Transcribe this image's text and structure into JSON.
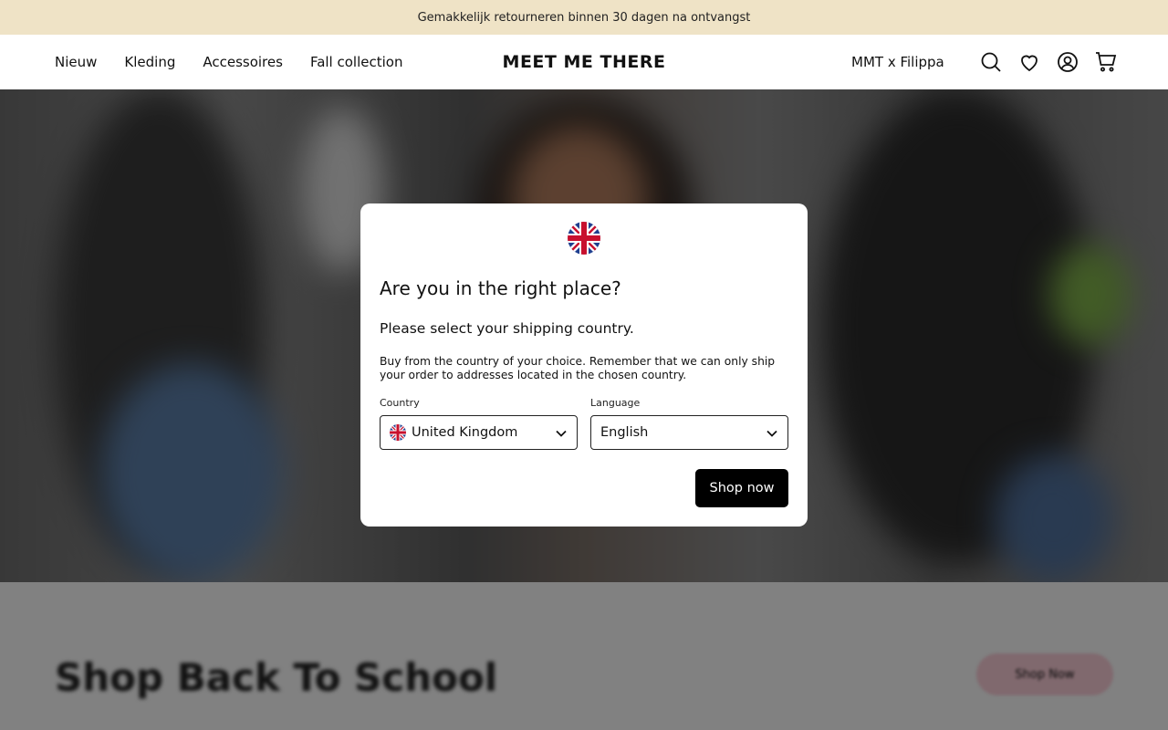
{
  "announcement": {
    "text": "Gemakkelijk retourneren binnen 30 dagen na ontvangst"
  },
  "header": {
    "nav": [
      "Nieuw",
      "Kleding",
      "Accessoires",
      "Fall collection"
    ],
    "logo": "MEET ME THERE",
    "collab_link": "MMT x Filippa",
    "icons": [
      "search-icon",
      "heart-icon",
      "account-icon",
      "cart-icon"
    ]
  },
  "section": {
    "title": "Shop Back To School",
    "button": "Shop Now"
  },
  "modal": {
    "title": "Are you in the right place?",
    "subtitle": "Please select your shipping country.",
    "description": "Buy from the country of your choice. Remember that we can only ship your order to addresses located in the chosen country.",
    "country_label": "Country",
    "country_value": "United Kingdom",
    "language_label": "Language",
    "language_value": "English",
    "submit": "Shop now"
  },
  "colors": {
    "announcement_bg": "#efe3c6",
    "button_bg": "#000000",
    "section_button": "#f6c9d3"
  }
}
